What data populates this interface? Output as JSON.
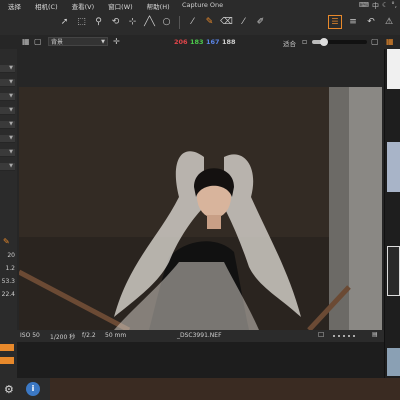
{
  "app": {
    "title": "Capture One"
  },
  "menubar": {
    "items": [
      "选择",
      "相机(C)",
      "查看(V)",
      "窗口(W)",
      "帮助(H)"
    ],
    "system_icons": [
      "keyboard-icon",
      "chinese-input-icon",
      "moon-icon",
      "punctuation-icon"
    ]
  },
  "system": {
    "ime_label": "中"
  },
  "toolbar": {
    "tools": [
      "select-icon",
      "crop-icon",
      "zoom-icon",
      "rotate-icon",
      "straighten-icon",
      "keystone-icon",
      "spot-icon",
      "picker-icon",
      "brush-icon",
      "eraser-icon",
      "gradient-icon",
      "pen-icon"
    ],
    "active_tool": "brush-icon",
    "accent_color": "#e8892b"
  },
  "viewerbar": {
    "style_label": "背景",
    "rgb": {
      "r": "206",
      "g": "183",
      "b": "167",
      "a": "188"
    },
    "rgb_colors": {
      "r": "#e0454a",
      "g": "#4cc84c",
      "b": "#5a84e6",
      "a": "#cfcfcf"
    },
    "zoom_label": "适合",
    "zoom_level": 0.22
  },
  "leftpanel": {
    "values": [
      "20",
      "1.2",
      "53.3",
      "22.4"
    ]
  },
  "infobar": {
    "iso": "ISO 50",
    "shutter": "1/200 秒",
    "aperture": "f/2.2",
    "focal": "50 mm",
    "filename": "_DSC3991.NEF"
  }
}
